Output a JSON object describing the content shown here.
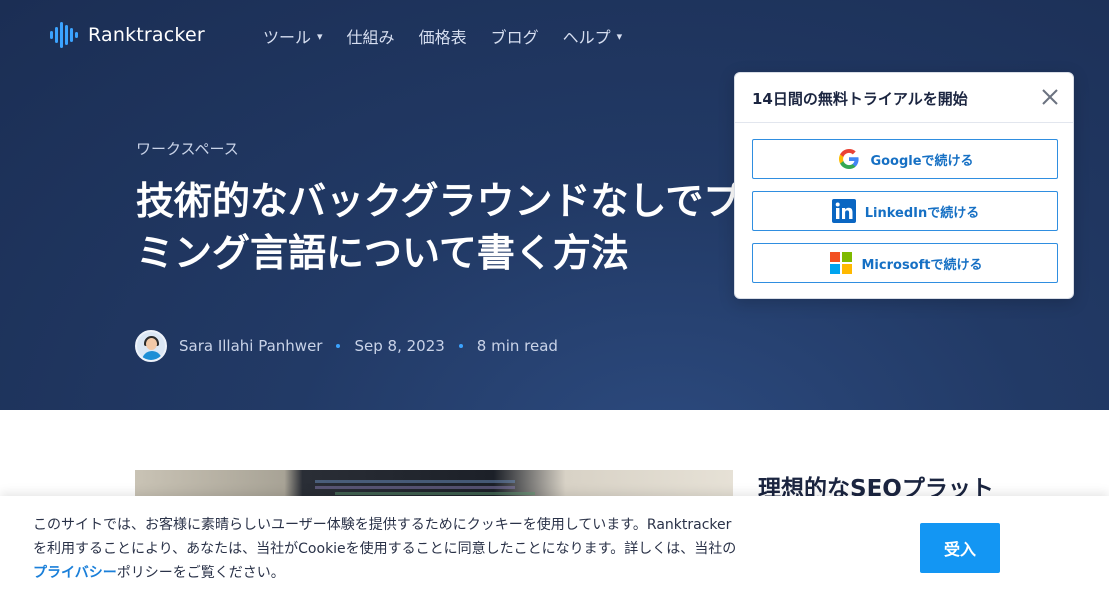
{
  "nav": {
    "brand": "Ranktracker",
    "items": [
      {
        "label": "ツール",
        "has_caret": true
      },
      {
        "label": "仕組み",
        "has_caret": false
      },
      {
        "label": "価格表",
        "has_caret": false
      },
      {
        "label": "ブログ",
        "has_caret": false
      },
      {
        "label": "ヘルプ",
        "has_caret": true
      }
    ],
    "caret_icon": "▾"
  },
  "article": {
    "category": "ワークスペース",
    "title_line1": "技術的なバックグラウンドなしでプログラ",
    "title_line2": "ミング言語について書く方法",
    "author": "Sara Illahi Panhwer",
    "date": "Sep 8, 2023",
    "read_time": "8 min read"
  },
  "popup": {
    "title": "14日間の無料トライアルを開始",
    "google_label": "Googleで続ける",
    "linkedin_label": "LinkedInで続ける",
    "microsoft_label": "Microsoftで続ける"
  },
  "sidebar": {
    "title": "理想的なSEOプラット"
  },
  "cookie": {
    "line1": "このサイトでは、お客様に素晴らしいユーザー体験を提供するためにクッキーを使用しています。Ranktracker",
    "line2": "を利用することにより、あなたは、当社がCookieを使用することに同意したことになります。詳しくは、当社の",
    "link": "プライバシー",
    "line3_rest": "ポリシーをご覧ください。",
    "accept_label": "受入"
  },
  "colors": {
    "hero_bg": "#1f3560",
    "accent": "#1396f3",
    "link": "#1a7fd9"
  }
}
